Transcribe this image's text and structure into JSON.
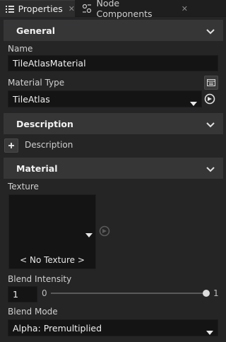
{
  "tabs": [
    {
      "label": "Properties",
      "icon": "list-icon",
      "close": "✕"
    },
    {
      "label": "Node Components",
      "icon": "components-icon",
      "close": "✕"
    }
  ],
  "general": {
    "header": "General",
    "name_label": "Name",
    "name_value": "TileAtlasMaterial",
    "material_type_label": "Material Type",
    "material_type_value": "TileAtlas"
  },
  "description": {
    "header": "Description",
    "add_label": "Description"
  },
  "material": {
    "header": "Material",
    "texture_label": "Texture",
    "texture_value": "< No Texture >",
    "blend_intensity_label": "Blend Intensity",
    "blend_intensity_value": "1",
    "slider_min": "0",
    "slider_max": "1",
    "slider_level": 1.0,
    "blend_mode_label": "Blend Mode",
    "blend_mode_value": "Alpha: Premultiplied"
  },
  "colors": {
    "background": "#252526",
    "section_header": "#363636",
    "field": "#141414",
    "text": "#d8d8d8"
  }
}
